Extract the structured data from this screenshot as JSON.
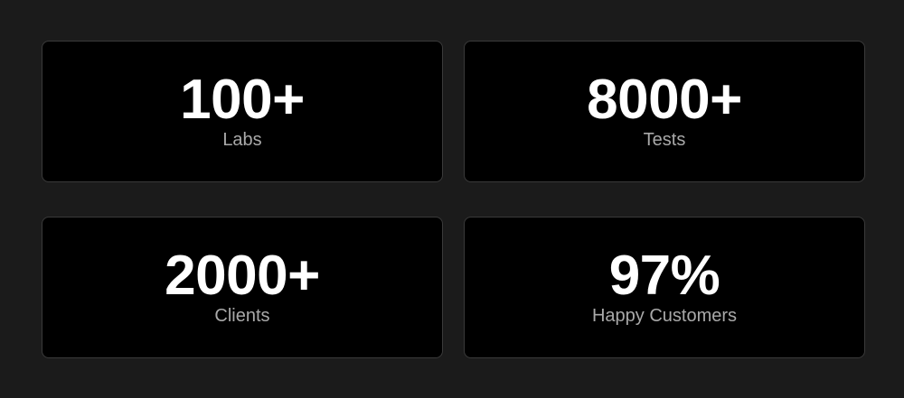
{
  "stats": [
    {
      "value": "100+",
      "label": "Labs"
    },
    {
      "value": "8000+",
      "label": "Tests"
    },
    {
      "value": "2000+",
      "label": "Clients"
    },
    {
      "value": "97%",
      "label": "Happy Customers"
    }
  ]
}
